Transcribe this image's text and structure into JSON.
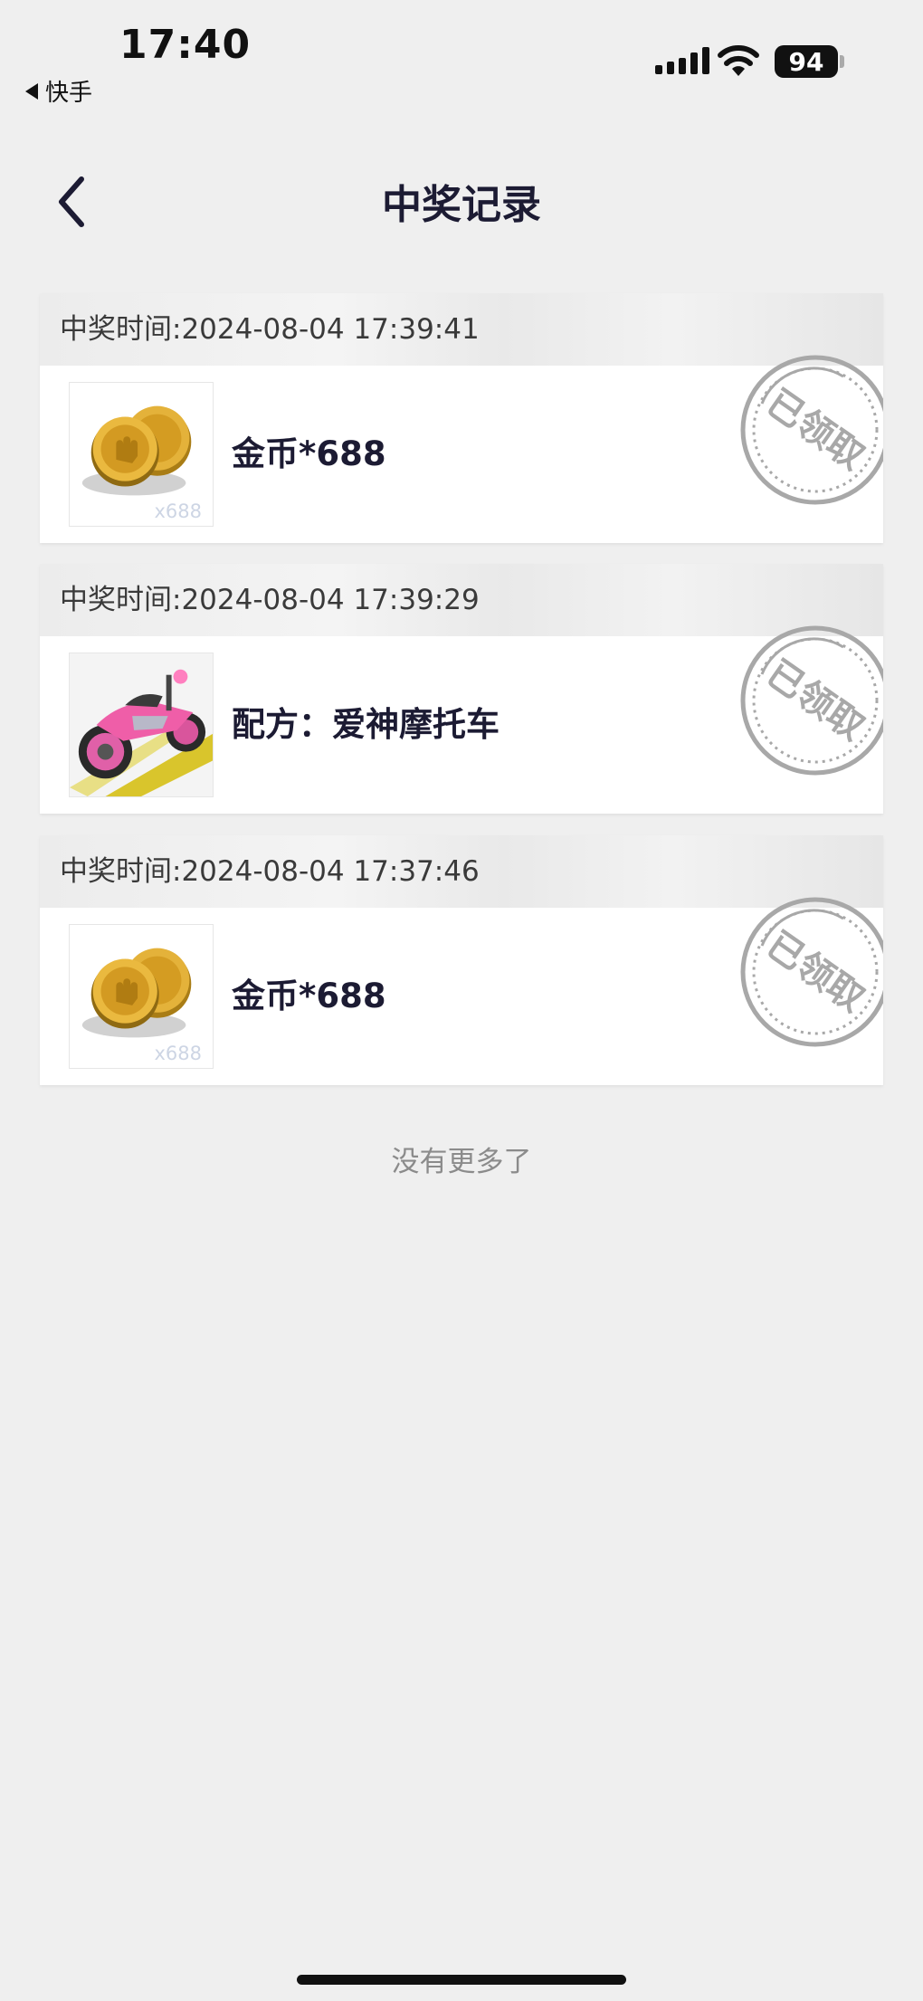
{
  "status_bar": {
    "time": "17:40",
    "back_app_label": "快手",
    "battery": "94"
  },
  "header": {
    "title": "中奖记录",
    "back_icon": "chevron-left-icon"
  },
  "records": [
    {
      "time_label": "中奖时间:2024-08-04 17:39:41",
      "prize_name": "金币*688",
      "image": "gold-coins-icon",
      "qty_badge": "x688",
      "stamp": "已领取"
    },
    {
      "time_label": "中奖时间:2024-08-04 17:39:29",
      "prize_name": "配方：爱神摩托车",
      "image": "pink-motorcycle-image",
      "qty_badge": "",
      "stamp": "已领取"
    },
    {
      "time_label": "中奖时间:2024-08-04 17:37:46",
      "prize_name": "金币*688",
      "image": "gold-coins-icon",
      "qty_badge": "x688",
      "stamp": "已领取"
    }
  ],
  "footer": {
    "no_more_text": "没有更多了"
  },
  "colors": {
    "background": "#efefef",
    "title_text": "#1c1b33",
    "stamp_gray": "#a8a8a8"
  }
}
